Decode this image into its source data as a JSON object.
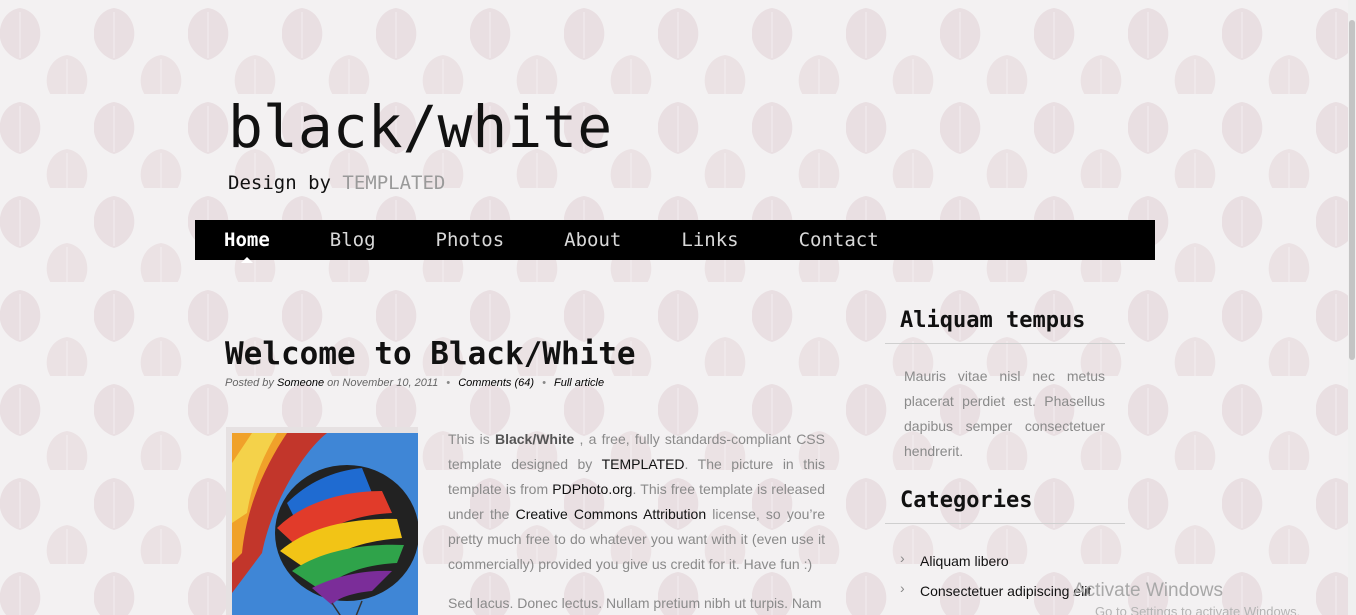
{
  "site": {
    "title": "black/white",
    "subtitle_prefix": "Design by",
    "subtitle_brand": "TEMPLATED"
  },
  "nav": {
    "items": [
      {
        "label": "Home",
        "active": true
      },
      {
        "label": "Blog",
        "active": false
      },
      {
        "label": "Photos",
        "active": false
      },
      {
        "label": "About",
        "active": false
      },
      {
        "label": "Links",
        "active": false
      },
      {
        "label": "Contact",
        "active": false
      }
    ]
  },
  "post": {
    "title": "Welcome to Black/White",
    "meta": {
      "posted_by": "Posted by",
      "author": "Someone",
      "on": "on November 10, 2011",
      "comments": "Comments (64)",
      "full_article": "Full article"
    },
    "body": {
      "p1_a": "This is ",
      "p1_bold": "Black/White",
      "p1_b": " , a free, fully standards-compliant CSS template designed by ",
      "p1_link1": "TEMPLATED",
      "p1_c": ". The picture in this template is from ",
      "p1_link2": "PDPhoto.org",
      "p1_d": ". This free template is released under the ",
      "p1_link3": "Creative Commons Attribution",
      "p1_e": " license, so you’re pretty much free to do whatever you want with it (even use it commercially) provided you give us credit for it. Have fun :)",
      "p2": "Sed lacus. Donec lectus. Nullam pretium nibh ut turpis. Nam"
    }
  },
  "sidebar": {
    "heading1": "Aliquam tempus",
    "text1": "Mauris vitae nisl nec metus placerat perdiet est. Phasellus dapibus semper consectetuer hendrerit.",
    "heading2": "Categories",
    "categories": [
      "Aliquam libero",
      "Consectetuer adipiscing elit"
    ]
  },
  "overlay": {
    "activate_title": "Activate Windows",
    "activate_sub": "Go to Settings to activate Windows."
  },
  "colors": {
    "background": "#f3f1f2",
    "nav_bg": "#000000",
    "leaf": "#e8dde0"
  }
}
